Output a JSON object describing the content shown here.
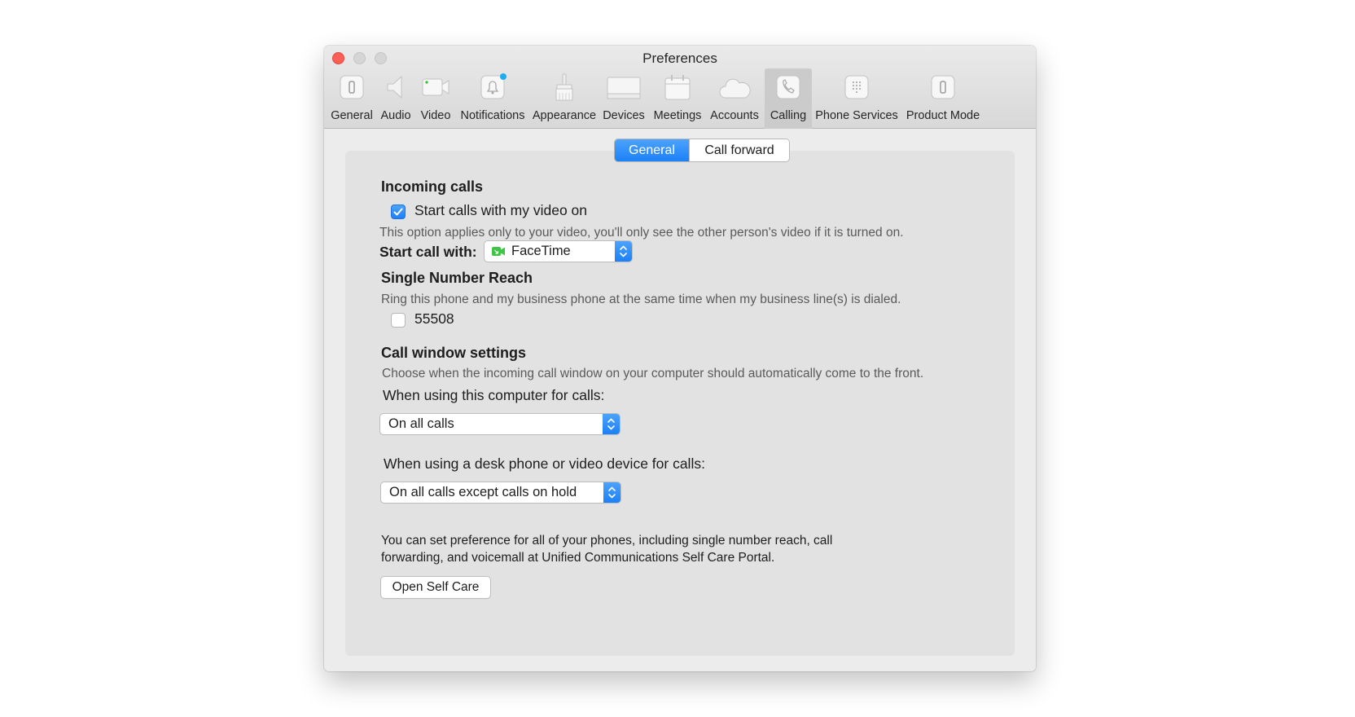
{
  "window": {
    "title": "Preferences"
  },
  "toolbar": {
    "items": [
      {
        "label": "General",
        "icon": "switch-icon"
      },
      {
        "label": "Audio",
        "icon": "speaker-icon"
      },
      {
        "label": "Video",
        "icon": "video-camera-icon"
      },
      {
        "label": "Notifications",
        "icon": "bell-icon"
      },
      {
        "label": "Appearance",
        "icon": "brush-icon"
      },
      {
        "label": "Devices",
        "icon": "monitor-icon"
      },
      {
        "label": "Meetings",
        "icon": "calendar-icon"
      },
      {
        "label": "Accounts",
        "icon": "cloud-icon"
      },
      {
        "label": "Calling",
        "icon": "phone-icon"
      },
      {
        "label": "Phone Services",
        "icon": "dialpad-icon"
      },
      {
        "label": "Product Mode",
        "icon": "toggle-icon"
      }
    ],
    "selected": "Calling"
  },
  "tabs": {
    "items": [
      {
        "label": "General"
      },
      {
        "label": "Call forward"
      }
    ],
    "selected": "General"
  },
  "incoming": {
    "heading": "Incoming calls",
    "video_checkbox_label": "Start calls with my video on",
    "video_checkbox_checked": true,
    "note": "This option applies only to your video, you'll only see the other person's video if it is turned on.",
    "start_call_label": "Start call with:",
    "start_call_value": "FaceTime"
  },
  "snr": {
    "heading": "Single Number Reach",
    "description": "Ring this phone and my business phone at the same time when my business line(s) is dialed.",
    "number_label": "55508",
    "number_checked": false
  },
  "callwindow": {
    "heading": "Call window settings",
    "description": "Choose when the incoming call window on your computer should automatically come to the front.",
    "computer_label": "When using this computer for calls:",
    "computer_value": "On all calls",
    "desk_label": "When using a desk phone or video device for calls:",
    "desk_value": "On all calls except calls on hold"
  },
  "selfcare": {
    "line1": "You can set preference for all of your phones, including single number reach, call",
    "line2": "forwarding, and voicemall at Unified Communications Self Care Portal.",
    "button_label": "Open Self Care"
  },
  "colors": {
    "accent": "#1b80f8",
    "close": "#fd5f57",
    "notification_dot": "#1aaef0",
    "facetime_green": "#3fc447"
  }
}
